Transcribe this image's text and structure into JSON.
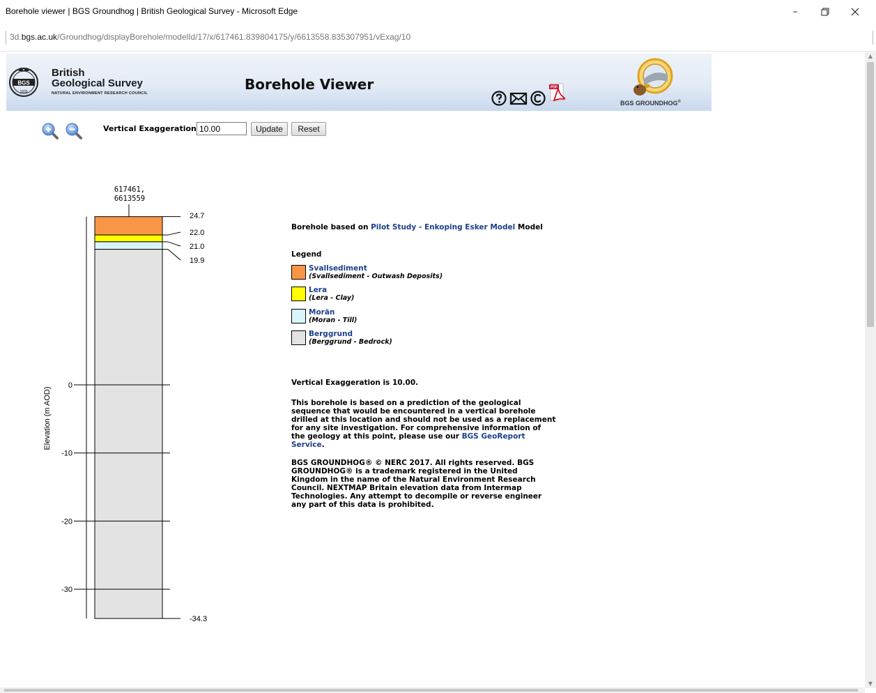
{
  "window": {
    "title": "Borehole viewer | BGS Groundhog | British Geological Survey - Microsoft Edge",
    "url_host": "3d.bgs.ac.uk",
    "url_prefix": "3d.",
    "url_domain": "bgs.ac.uk",
    "url_path": "/Groundhog/displayBorehole/modelId/17/x/617461.839804175/y/6613558.835307951/vExag/10",
    "minimize_icon": "minimize-icon",
    "restore_icon": "restore-icon",
    "close_icon": "close-icon"
  },
  "header": {
    "org_line1": "British",
    "org_line2": "Geological Survey",
    "org_line3": "NATURAL ENVIRONMENT RESEARCH COUNCIL",
    "seal_text": "BGS",
    "seal_year": "1835",
    "page_title": "Borehole Viewer",
    "groundhog_logo_text": "BGS GROUNDHOG",
    "groundhog_logo_mark": "®",
    "icons": [
      "help-icon",
      "email-icon",
      "copyright-icon",
      "pdf-icon"
    ],
    "pdf_label": "PDF"
  },
  "controls": {
    "zoom_in_icon": "zoom-in-icon",
    "zoom_out_icon": "zoom-out-icon",
    "ve_label": "Vertical Exaggeration",
    "ve_value": "10.00",
    "update_label": "Update",
    "reset_label": "Reset"
  },
  "chart_data": {
    "type": "borehole-log",
    "location_label_line1": "617461,",
    "location_label_line2": "6613559",
    "ylabel": "Elevation (m AOD)",
    "ylim": [
      -34.3,
      24.7
    ],
    "y_ticks": [
      0,
      -10,
      -20,
      -30
    ],
    "tick_labels": [
      "0",
      "-10",
      "-20",
      "-30"
    ],
    "layers": [
      {
        "name": "Svallsediment",
        "top": 24.7,
        "bottom": 22.0,
        "color": "#f79646"
      },
      {
        "name": "Lera",
        "top": 22.0,
        "bottom": 21.0,
        "color": "#ffff00"
      },
      {
        "name": "Morän",
        "top": 21.0,
        "bottom": 19.9,
        "color": "#d9f5fb"
      },
      {
        "name": "Berggrund",
        "top": 19.9,
        "bottom": -34.3,
        "color": "#e3e3e3"
      }
    ],
    "boundary_labels": [
      "24.7",
      "22.0",
      "21.0",
      "19.9",
      "-34.3"
    ],
    "boundary_values": [
      24.7,
      22.0,
      21.0,
      19.9,
      -34.3
    ]
  },
  "info": {
    "based_prefix": "Borehole based on ",
    "model_link": "Pilot Study - Enkoping Esker Model",
    "based_suffix": " Model",
    "legend_title": "Legend",
    "legend": [
      {
        "name": "Svallsediment",
        "desc": "(Svallsediment - Outwash Deposits)",
        "color": "#f79646"
      },
      {
        "name": "Lera",
        "desc": "(Lera - Clay)",
        "color": "#ffff00"
      },
      {
        "name": "Morän",
        "desc": "(Moran - Till)",
        "color": "#d9f5fb"
      },
      {
        "name": "Berggrund",
        "desc": "(Berggrund - Bedrock)",
        "color": "#e3e3e3"
      }
    ],
    "ve_statement": "Vertical Exaggeration is 10.00.",
    "disclaimer_text": "This borehole is based on a prediction of the geological sequence that would be encountered in a vertical borehole drilled at this location and should not be used as a replacement for any site investigation. For comprehensive information of the geology at this point, please use our ",
    "disclaimer_link": "BGS GeoReport Service",
    "disclaimer_end": ".",
    "copyright_text": "BGS GROUNDHOG® © NERC 2017. All rights reserved. BGS GROUNDHOG® is a trademark registered in the United Kingdom in the name of the Natural Environment Research Council. NEXTMAP Britain elevation data from Intermap Technologies. Any attempt to decompile or reverse engineer any part of this data is prohibited."
  }
}
